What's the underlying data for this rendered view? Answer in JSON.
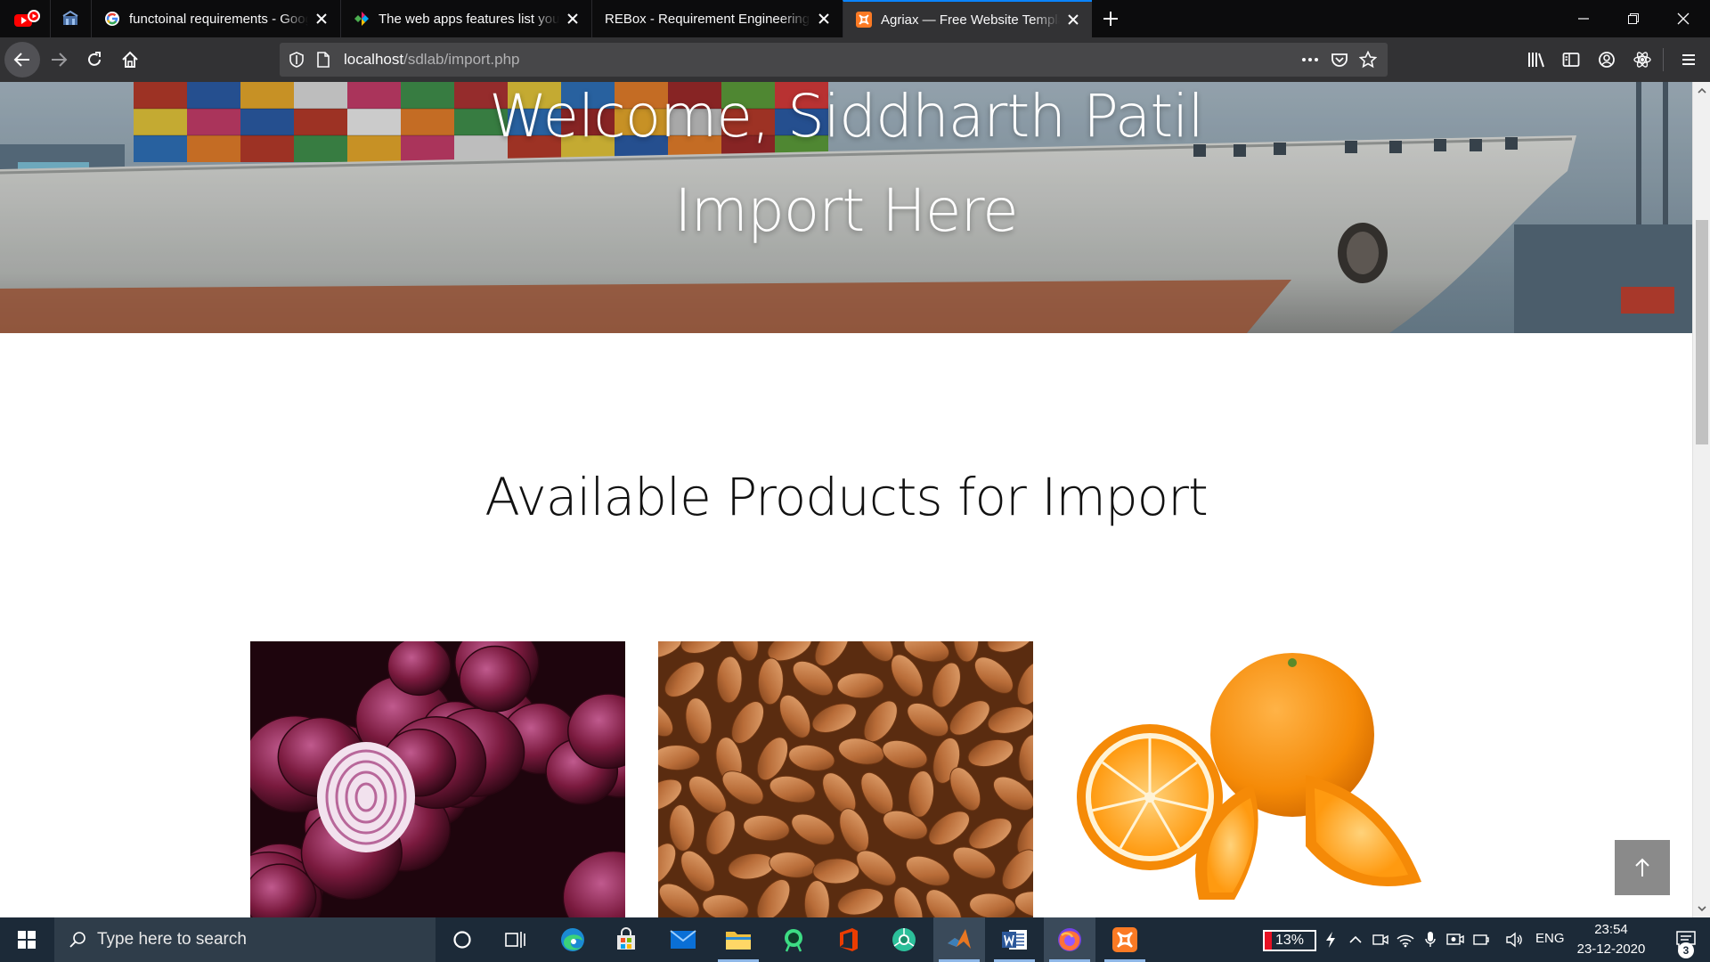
{
  "browser": {
    "pinned_tabs": [
      {
        "icon": "youtube-icon"
      },
      {
        "icon": "pinned-site-icon"
      }
    ],
    "tabs": [
      {
        "title": "functoinal requirements - Google Search",
        "icon": "google-icon",
        "active": false
      },
      {
        "title": "The web apps features list you need",
        "icon": "colorful-logo-icon",
        "active": false
      },
      {
        "title": "REBox - Requirement Engineering Box",
        "icon": "none",
        "active": false
      },
      {
        "title": "Agriax — Free Website Template",
        "icon": "xampp-icon",
        "active": true
      }
    ],
    "url": {
      "host": "localhost",
      "path": "/sdlab/import.php"
    },
    "accent_color": "#0a84ff"
  },
  "page": {
    "hero": {
      "welcome": "Welcome, Siddharth Patil",
      "subtitle": "Import Here"
    },
    "section_title": "Available Products for Import",
    "products": [
      {
        "image": "red-onions-image"
      },
      {
        "image": "almonds-image"
      },
      {
        "image": "oranges-image"
      }
    ],
    "scroll_top_icon": "arrow-up-icon"
  },
  "taskbar": {
    "search_placeholder": "Type here to search",
    "apps": [
      "cortana-icon",
      "task-view-icon",
      "edge-icon",
      "store-icon",
      "mail-icon",
      "file-explorer-icon",
      "android-studio-icon",
      "office-icon",
      "chrome-canary-icon",
      "matlab-icon",
      "word-icon",
      "firefox-icon",
      "xampp-icon"
    ],
    "battery": "13%",
    "language": "ENG",
    "time": "23:54",
    "date": "23-12-2020",
    "notifications": "3"
  }
}
